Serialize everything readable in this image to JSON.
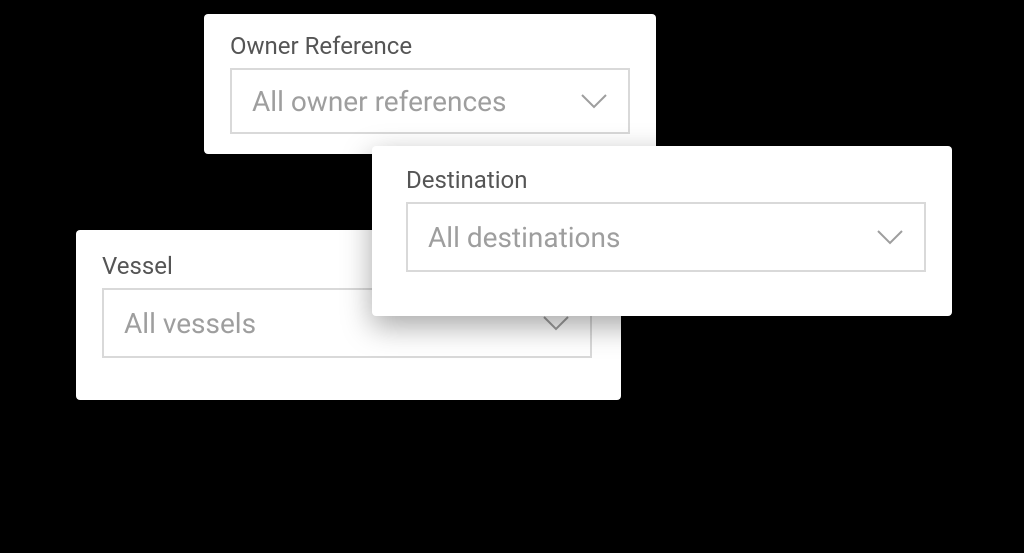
{
  "filters": {
    "owner_reference": {
      "label": "Owner Reference",
      "selected": "All owner references"
    },
    "destination": {
      "label": "Destination",
      "selected": "All destinations"
    },
    "vessel": {
      "label": "Vessel",
      "selected": "All vessels"
    }
  },
  "icons": {
    "chevron_down": "chevron-down-icon"
  },
  "colors": {
    "background": "#000000",
    "card_bg": "#ffffff",
    "label_text": "#555555",
    "value_text": "#9e9e9e",
    "border": "#d9d9d9"
  }
}
